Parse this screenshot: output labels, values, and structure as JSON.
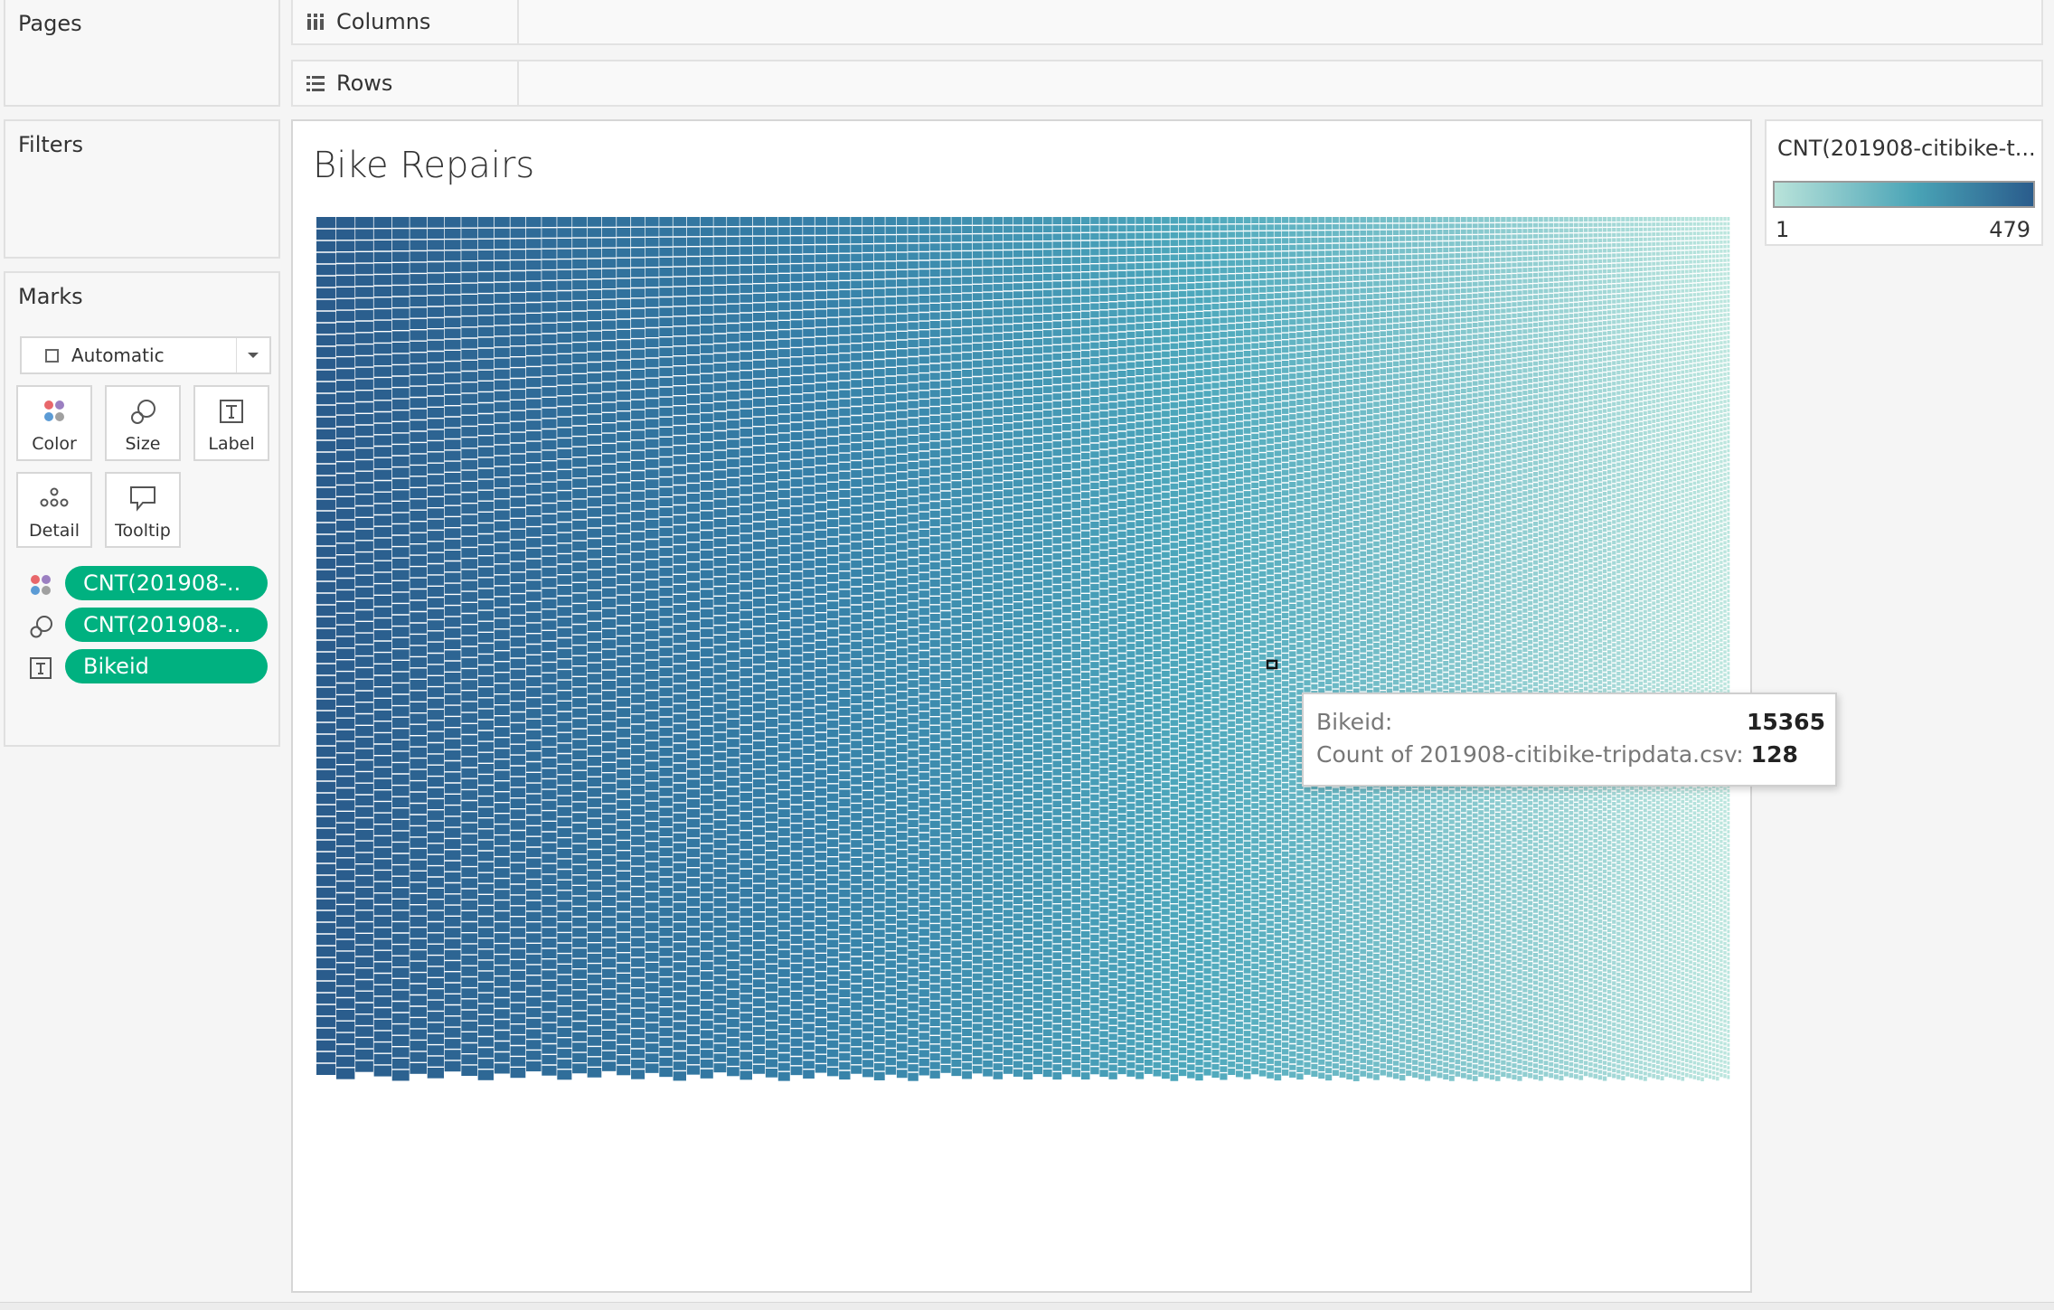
{
  "panels": {
    "pages": "Pages",
    "filters": "Filters",
    "marks": "Marks"
  },
  "shelves": {
    "columns": "Columns",
    "rows": "Rows"
  },
  "marks_card": {
    "type": "Automatic",
    "buttons": {
      "color": "Color",
      "size": "Size",
      "label": "Label",
      "detail": "Detail",
      "tooltip": "Tooltip"
    },
    "pills": [
      {
        "role": "color",
        "label": "CNT(201908-.."
      },
      {
        "role": "size",
        "label": "CNT(201908-.."
      },
      {
        "role": "label",
        "label": "Bikeid"
      }
    ]
  },
  "sheet": {
    "title": "Bike Repairs"
  },
  "legend": {
    "title": "CNT(201908-citibike-t...",
    "min": "1",
    "max": "479",
    "color_low": "#b9e3da",
    "color_high": "#2a5c8c"
  },
  "tooltip": {
    "rows": [
      {
        "key": "Bikeid:",
        "value": "15365"
      },
      {
        "key": "Count of 201908-citibike-tripdata.csv:",
        "value": "128"
      }
    ]
  },
  "chart_data": {
    "type": "heatmap",
    "title": "Bike Repairs",
    "measure": "Count of 201908-citibike-tripdata.csv",
    "color_range": [
      1,
      479
    ],
    "highlighted": {
      "bikeid": 15365,
      "count": 128
    }
  },
  "colors": {
    "pill": "#00b180",
    "color_icon_dots": [
      "#e8676b",
      "#9b7fc1",
      "#5b9bd5",
      "#a0a0a0"
    ]
  }
}
